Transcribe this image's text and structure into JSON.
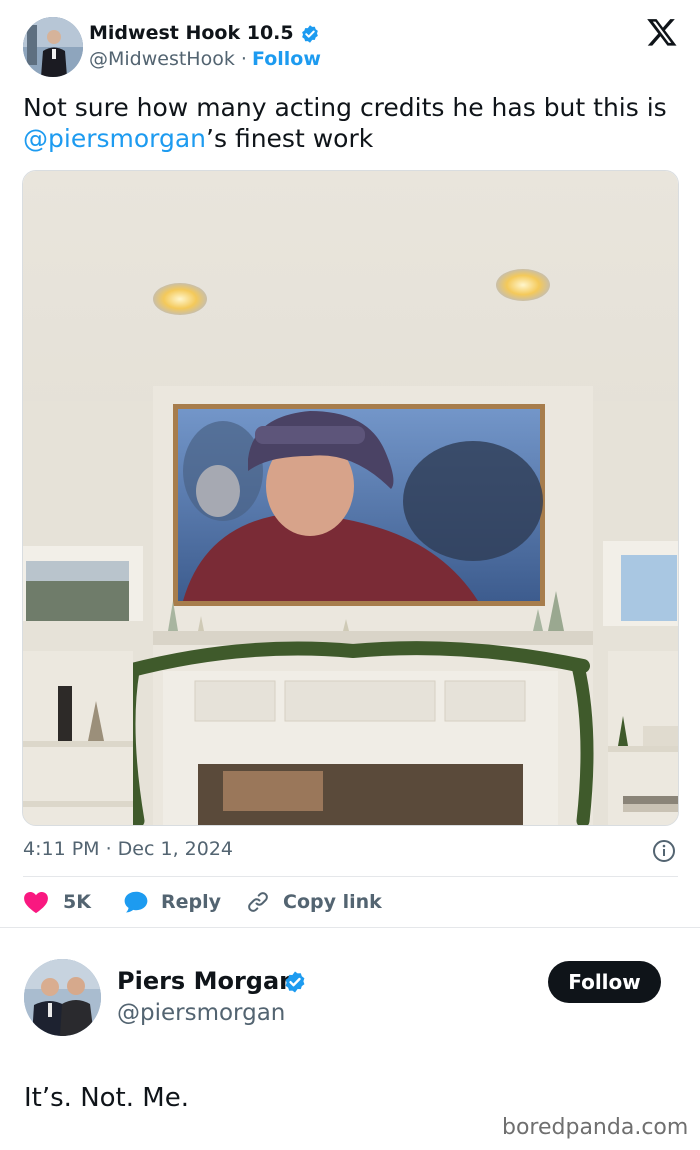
{
  "tweet": {
    "author": {
      "name": "Midwest Hook 10.5",
      "handle": "@MidwestHook",
      "separator": "·",
      "follow_label": "Follow",
      "verified": true
    },
    "text_before": "Not sure how many acting credits he has but this is ",
    "mention": "@piersmorgan",
    "text_after": "’s finest work",
    "timestamp": "4:11 PM · Dec 1, 2024",
    "actions": {
      "like_count": "5K",
      "reply_label": "Reply",
      "copy_label": "Copy link"
    },
    "photo_alt": "",
    "icons": {
      "platform": "x-logo-icon",
      "verified": "verified-badge-icon",
      "info": "info-icon",
      "like": "heart-icon",
      "reply": "speech-bubble-icon",
      "copy": "link-icon"
    }
  },
  "reply": {
    "author": {
      "name": "Piers Morgan",
      "handle": "@piersmorgan",
      "verified": true
    },
    "follow_button_label": "Follow",
    "text": "It’s. Not. Me."
  },
  "watermark": "boredpanda.com",
  "colors": {
    "accent": "#1d9bf0",
    "text_primary": "#0f1419",
    "text_secondary": "#536471",
    "like": "#f91880",
    "follow_button_bg": "#0f1419"
  }
}
